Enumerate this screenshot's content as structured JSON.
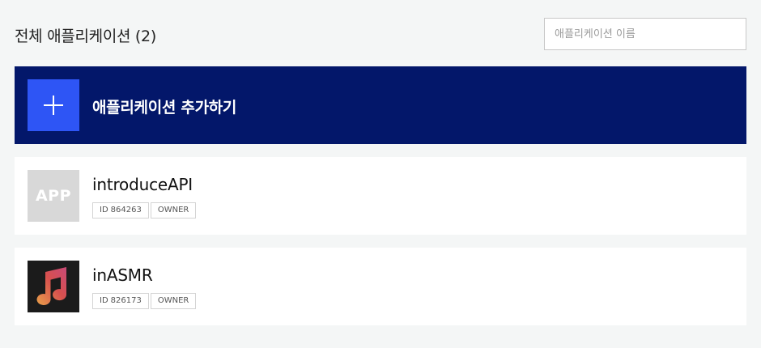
{
  "header": {
    "title": "전체 애플리케이션 (2)",
    "search_placeholder": "애플리케이션 이름",
    "search_value": ""
  },
  "add_card": {
    "label": "애플리케이션 추가하기",
    "icon": "plus-icon"
  },
  "apps": [
    {
      "name": "introduceAPI",
      "icon_text": "APP",
      "id_prefix": "ID",
      "id": "864263",
      "role": "OWNER"
    },
    {
      "name": "inASMR",
      "icon": "music-note-icon",
      "id_prefix": "ID",
      "id": "826173",
      "role": "OWNER"
    }
  ],
  "colors": {
    "background": "#f4f6f6",
    "add_card_bg": "#03176a",
    "add_icon_bg": "#2e55f5",
    "placeholder_icon_bg": "#d8d8d8"
  }
}
